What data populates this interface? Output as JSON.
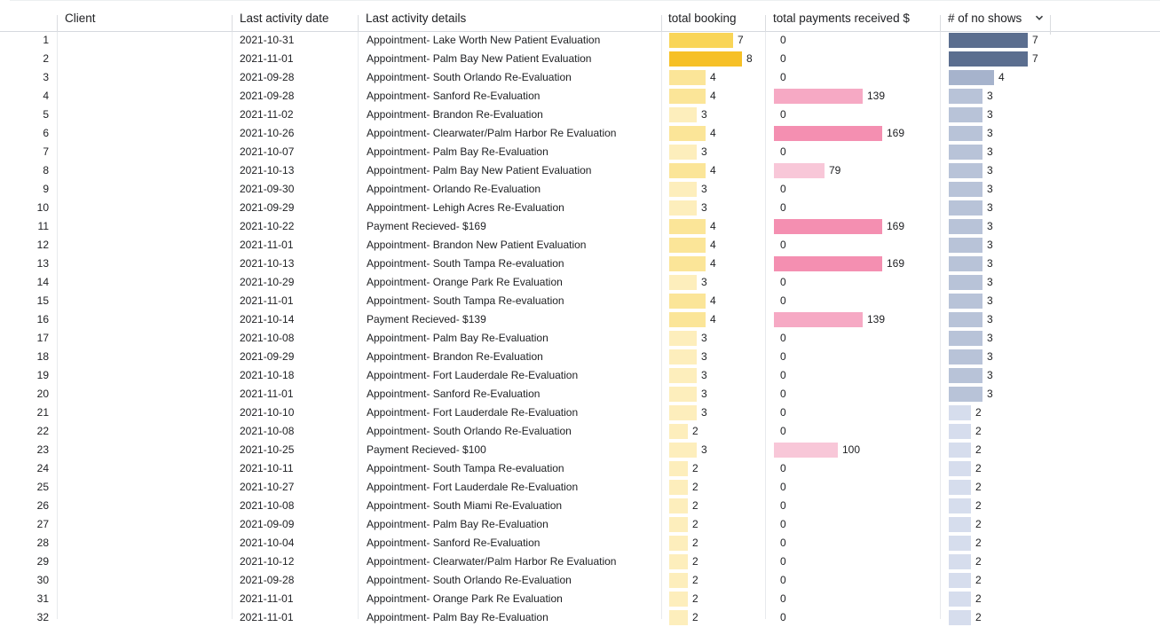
{
  "table": {
    "columns": [
      {
        "key": "client",
        "label": "Client"
      },
      {
        "key": "date",
        "label": "Last activity date"
      },
      {
        "key": "details",
        "label": "Last activity details"
      },
      {
        "key": "booking",
        "label": "total booking"
      },
      {
        "key": "payments",
        "label": "total payments received $"
      },
      {
        "key": "noshows",
        "label": "# of no shows"
      }
    ],
    "sort_icon": "chevron-down-icon",
    "client_values_visible": false,
    "bar_colors": {
      "booking_max": "#f6c026",
      "booking_mid": "#f9d558",
      "booking_light": "#fbe598",
      "booking_lighter": "#fdeebc",
      "payments_strong": "#f48fb1",
      "payments_mid": "#f6a9c4",
      "payments_light": "#f8c7d8",
      "noshows_strong": "#5b6e8f",
      "noshows_mid": "#a6b3cc",
      "noshows_light": "#b8c3d8",
      "noshows_lighter": "#d6dded"
    },
    "rows": [
      {
        "n": "1",
        "date": "2021-10-31",
        "details": "Appointment- Lake Worth New Patient Evaluation",
        "booking": 7,
        "payments": 0,
        "noshows": 7
      },
      {
        "n": "2",
        "date": "2021-11-01",
        "details": "Appointment- Palm Bay New Patient Evaluation",
        "booking": 8,
        "payments": 0,
        "noshows": 7
      },
      {
        "n": "3",
        "date": "2021-09-28",
        "details": "Appointment- South Orlando Re-Evaluation",
        "booking": 4,
        "payments": 0,
        "noshows": 4
      },
      {
        "n": "4",
        "date": "2021-09-28",
        "details": "Appointment- Sanford Re-Evaluation",
        "booking": 4,
        "payments": 139,
        "noshows": 3
      },
      {
        "n": "5",
        "date": "2021-11-02",
        "details": "Appointment- Brandon Re-Evaluation",
        "booking": 3,
        "payments": 0,
        "noshows": 3
      },
      {
        "n": "6",
        "date": "2021-10-26",
        "details": "Appointment- Clearwater/Palm Harbor Re Evaluation",
        "booking": 4,
        "payments": 169,
        "noshows": 3
      },
      {
        "n": "7",
        "date": "2021-10-07",
        "details": "Appointment- Palm Bay Re-Evaluation",
        "booking": 3,
        "payments": 0,
        "noshows": 3
      },
      {
        "n": "8",
        "date": "2021-10-13",
        "details": "Appointment- Palm Bay New Patient Evaluation",
        "booking": 4,
        "payments": 79,
        "noshows": 3
      },
      {
        "n": "9",
        "date": "2021-09-30",
        "details": "Appointment- Orlando Re-Evaluation",
        "booking": 3,
        "payments": 0,
        "noshows": 3
      },
      {
        "n": "10",
        "date": "2021-09-29",
        "details": "Appointment- Lehigh Acres Re-Evaluation",
        "booking": 3,
        "payments": 0,
        "noshows": 3
      },
      {
        "n": "11",
        "date": "2021-10-22",
        "details": "Payment Recieved- $169",
        "booking": 4,
        "payments": 169,
        "noshows": 3
      },
      {
        "n": "12",
        "date": "2021-11-01",
        "details": "Appointment- Brandon New Patient Evaluation",
        "booking": 4,
        "payments": 0,
        "noshows": 3
      },
      {
        "n": "13",
        "date": "2021-10-13",
        "details": "Appointment- South Tampa Re-evaluation",
        "booking": 4,
        "payments": 169,
        "noshows": 3
      },
      {
        "n": "14",
        "date": "2021-10-29",
        "details": "Appointment- Orange Park Re Evaluation",
        "booking": 3,
        "payments": 0,
        "noshows": 3
      },
      {
        "n": "15",
        "date": "2021-11-01",
        "details": "Appointment- South Tampa Re-evaluation",
        "booking": 4,
        "payments": 0,
        "noshows": 3
      },
      {
        "n": "16",
        "date": "2021-10-14",
        "details": "Payment Recieved- $139",
        "booking": 4,
        "payments": 139,
        "noshows": 3
      },
      {
        "n": "17",
        "date": "2021-10-08",
        "details": "Appointment- Palm Bay Re-Evaluation",
        "booking": 3,
        "payments": 0,
        "noshows": 3
      },
      {
        "n": "18",
        "date": "2021-09-29",
        "details": "Appointment- Brandon Re-Evaluation",
        "booking": 3,
        "payments": 0,
        "noshows": 3
      },
      {
        "n": "19",
        "date": "2021-10-18",
        "details": "Appointment- Fort Lauderdale Re-Evaluation",
        "booking": 3,
        "payments": 0,
        "noshows": 3
      },
      {
        "n": "20",
        "date": "2021-11-01",
        "details": "Appointment- Sanford Re-Evaluation",
        "booking": 3,
        "payments": 0,
        "noshows": 3
      },
      {
        "n": "21",
        "date": "2021-10-10",
        "details": "Appointment- Fort Lauderdale Re-Evaluation",
        "booking": 3,
        "payments": 0,
        "noshows": 2
      },
      {
        "n": "22",
        "date": "2021-10-08",
        "details": "Appointment- South Orlando Re-Evaluation",
        "booking": 2,
        "payments": 0,
        "noshows": 2
      },
      {
        "n": "23",
        "date": "2021-10-25",
        "details": "Payment Recieved- $100",
        "booking": 3,
        "payments": 100,
        "noshows": 2
      },
      {
        "n": "24",
        "date": "2021-10-11",
        "details": "Appointment- South Tampa Re-evaluation",
        "booking": 2,
        "payments": 0,
        "noshows": 2
      },
      {
        "n": "25",
        "date": "2021-10-27",
        "details": "Appointment- Fort Lauderdale Re-Evaluation",
        "booking": 2,
        "payments": 0,
        "noshows": 2
      },
      {
        "n": "26",
        "date": "2021-10-08",
        "details": "Appointment- South Miami Re-Evaluation",
        "booking": 2,
        "payments": 0,
        "noshows": 2
      },
      {
        "n": "27",
        "date": "2021-09-09",
        "details": "Appointment- Palm Bay Re-Evaluation",
        "booking": 2,
        "payments": 0,
        "noshows": 2
      },
      {
        "n": "28",
        "date": "2021-10-04",
        "details": "Appointment- Sanford Re-Evaluation",
        "booking": 2,
        "payments": 0,
        "noshows": 2
      },
      {
        "n": "29",
        "date": "2021-10-12",
        "details": "Appointment- Clearwater/Palm Harbor Re Evaluation",
        "booking": 2,
        "payments": 0,
        "noshows": 2
      },
      {
        "n": "30",
        "date": "2021-09-28",
        "details": "Appointment- South Orlando Re-Evaluation",
        "booking": 2,
        "payments": 0,
        "noshows": 2
      },
      {
        "n": "31",
        "date": "2021-11-01",
        "details": "Appointment- Orange Park Re Evaluation",
        "booking": 2,
        "payments": 0,
        "noshows": 2
      },
      {
        "n": "32",
        "date": "2021-11-01",
        "details": "Appointment- Palm Bay Re-Evaluation",
        "booking": 2,
        "payments": 0,
        "noshows": 2
      }
    ]
  }
}
